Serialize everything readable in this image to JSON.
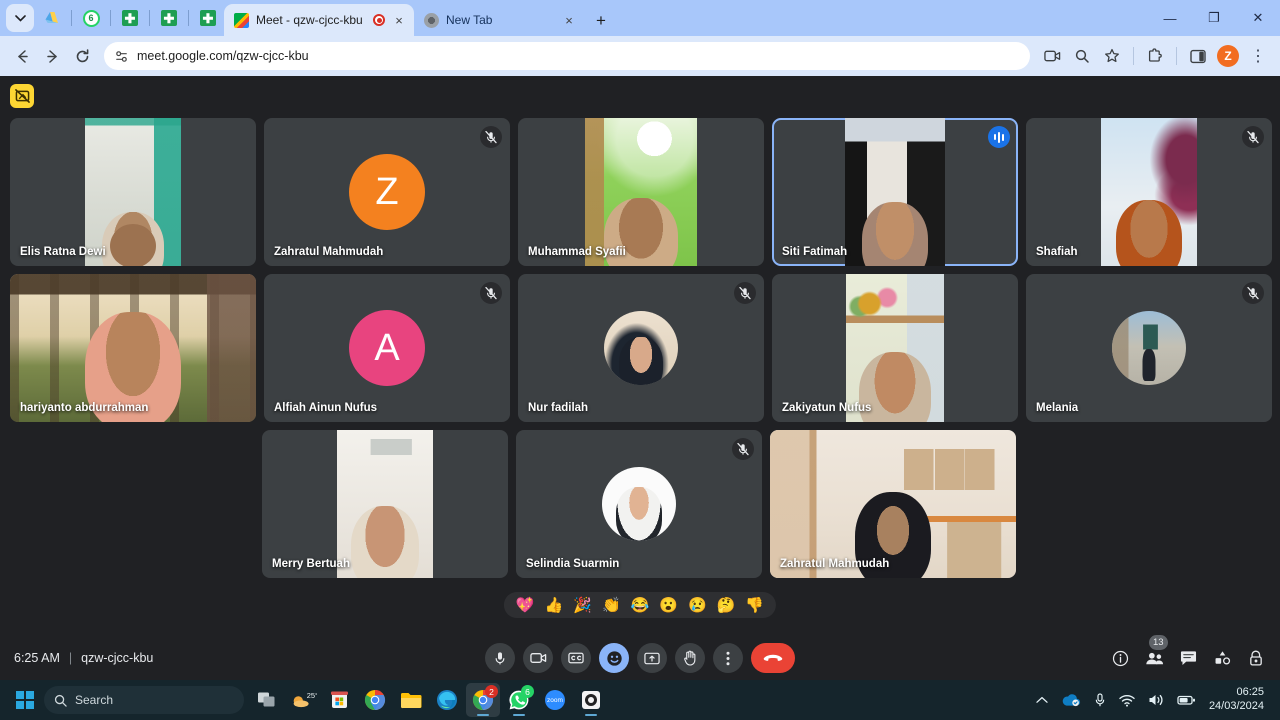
{
  "browser": {
    "pinned_tabs": [
      {
        "name": "tab-list-dropdown",
        "icon": "chevron-down-icon"
      },
      {
        "name": "pinned-drive-tab",
        "icon": "google-drive-icon"
      },
      {
        "name": "pinned-whatsapp-tab",
        "icon": "whatsapp-icon",
        "badge": "6"
      },
      {
        "name": "pinned-sheets-tab-1",
        "icon": "google-sheets-icon"
      },
      {
        "name": "pinned-sheets-tab-2",
        "icon": "google-sheets-icon"
      },
      {
        "name": "pinned-sheets-tab-3",
        "icon": "google-sheets-icon"
      }
    ],
    "tabs": [
      {
        "title": "Meet - qzw-cjcc-kbu",
        "favicon": "google-meet-icon",
        "recording": true,
        "active": true,
        "close": "×"
      },
      {
        "title": "New Tab",
        "favicon": "chrome-icon",
        "recording": false,
        "active": false,
        "close": "×"
      }
    ],
    "new_tab_label": "+",
    "window_controls": {
      "minimize": "—",
      "maximize": "❐",
      "close": "✕"
    },
    "address": "meet.google.com/qzw-cjcc-kbu",
    "nav": {
      "back": "←",
      "forward": "→",
      "reload": "↻"
    },
    "toolbar_icons": [
      "site-settings-icon",
      "media-cast-icon",
      "zoom-search-icon",
      "bookmark-star-icon",
      "extensions-icon",
      "side-panel-icon"
    ],
    "profile_initial": "Z",
    "menu_icon": "⋮"
  },
  "meet": {
    "recording_badge_icon": "no-screen-share-icon",
    "participants": [
      {
        "name": "Elis Ratna Dewi",
        "media": "video-portrait",
        "muted": false,
        "speaking": false,
        "video_style": "room-white"
      },
      {
        "name": "Zahratul Mahmudah",
        "media": "initial-avatar",
        "initial": "Z",
        "avatar_color": "#f4811f",
        "muted": true,
        "speaking": false
      },
      {
        "name": "Muhammad Syafii",
        "media": "video-portrait",
        "muted": false,
        "speaking": false,
        "video_style": "room-green"
      },
      {
        "name": "Siti Fatimah",
        "media": "video-portrait",
        "muted": false,
        "speaking": true,
        "active_speaker": true,
        "video_style": "room-door"
      },
      {
        "name": "Shafiah",
        "media": "video-portrait",
        "muted": true,
        "speaking": false,
        "video_style": "room-window"
      },
      {
        "name": "hariyanto abdurrahman",
        "media": "video-full",
        "muted": false,
        "speaking": false,
        "video_style": "vineyard"
      },
      {
        "name": "Alfiah Ainun Nufus",
        "media": "initial-avatar",
        "initial": "A",
        "avatar_color": "#e8447f",
        "muted": true,
        "speaking": false
      },
      {
        "name": "Nur fadilah",
        "media": "photo-avatar",
        "muted": true,
        "speaking": false,
        "avatar_style": "portrait-beige"
      },
      {
        "name": "Zakiyatun Nufus",
        "media": "video-portrait",
        "muted": false,
        "speaking": false,
        "video_style": "shelf-room"
      },
      {
        "name": "Melania",
        "media": "photo-avatar",
        "muted": true,
        "speaking": false,
        "avatar_style": "street-scene"
      },
      {
        "name": "Merry Bertuah",
        "media": "video-portrait",
        "muted": false,
        "speaking": false,
        "video_style": "room-vent"
      },
      {
        "name": "Selindia Suarmin",
        "media": "photo-avatar",
        "muted": true,
        "speaking": false,
        "avatar_style": "white-studio"
      },
      {
        "name": "Zahratul Mahmudah",
        "media": "video-full",
        "muted": false,
        "speaking": false,
        "video_style": "office-desk"
      }
    ],
    "reactions": [
      "💖",
      "👍",
      "🎉",
      "👏",
      "😂",
      "😮",
      "😢",
      "🤔",
      "👎"
    ],
    "time": "6:25 AM",
    "separator": "|",
    "meeting_code": "qzw-cjcc-kbu",
    "controls": [
      {
        "name": "microphone-button",
        "icon": "mic-icon",
        "active": false
      },
      {
        "name": "camera-button",
        "icon": "video-camera-icon",
        "active": false
      },
      {
        "name": "captions-button",
        "icon": "closed-caption-icon",
        "active": false
      },
      {
        "name": "reactions-button",
        "icon": "emoji-smiley-icon",
        "active": true
      },
      {
        "name": "present-screen-button",
        "icon": "present-screen-icon",
        "active": false
      },
      {
        "name": "raise-hand-button",
        "icon": "raise-hand-icon",
        "active": false
      },
      {
        "name": "more-options-button",
        "icon": "three-dot-menu-icon",
        "active": false
      },
      {
        "name": "leave-call-button",
        "icon": "hangup-phone-icon",
        "active": false
      }
    ],
    "right_controls": [
      {
        "name": "meeting-details-button",
        "icon": "info-icon"
      },
      {
        "name": "participants-button",
        "icon": "people-icon",
        "count": "13"
      },
      {
        "name": "chat-button",
        "icon": "chat-bubble-icon"
      },
      {
        "name": "activities-button",
        "icon": "activities-shapes-icon"
      },
      {
        "name": "host-controls-button",
        "icon": "lock-shield-icon"
      }
    ]
  },
  "taskbar": {
    "start_label": "start-button",
    "search_placeholder": "Search",
    "apps": [
      {
        "name": "task-view",
        "icon": "task-view-icon"
      },
      {
        "name": "weather-widget",
        "icon": "weather-icon",
        "label": "25°"
      },
      {
        "name": "microsoft-store",
        "icon": "store-icon"
      },
      {
        "name": "chrome",
        "icon": "chrome-icon"
      },
      {
        "name": "file-explorer",
        "icon": "folder-icon"
      },
      {
        "name": "microsoft-edge",
        "icon": "edge-icon"
      },
      {
        "name": "chrome-active",
        "icon": "chrome-icon",
        "badge": "2",
        "active": true
      },
      {
        "name": "whatsapp",
        "icon": "whatsapp-icon",
        "badge": "6"
      },
      {
        "name": "zoom",
        "icon": "zoom-icon",
        "label": "zoom"
      },
      {
        "name": "screen-recorder",
        "icon": "camera-app-icon"
      }
    ],
    "tray": [
      "chevron-up-icon",
      "onedrive-icon",
      "microphone-icon",
      "wifi-icon",
      "volume-icon",
      "battery-icon"
    ],
    "clock_time": "06:25",
    "clock_date": "24/03/2024"
  }
}
